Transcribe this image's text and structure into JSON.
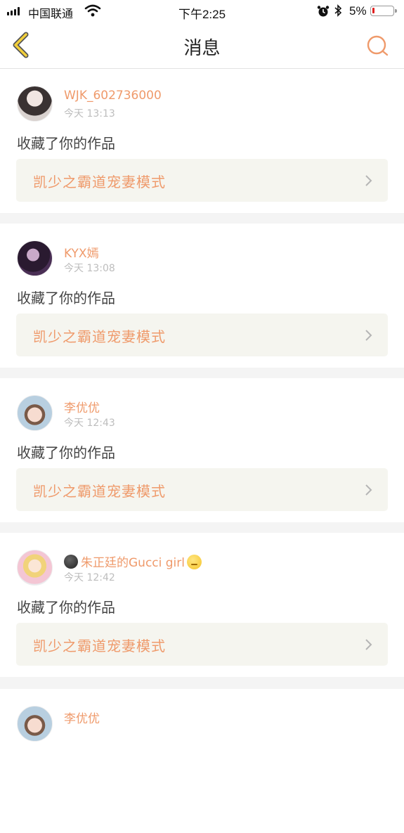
{
  "status_bar": {
    "carrier": "中国联通",
    "time": "下午2:25",
    "battery_percent": "5%"
  },
  "nav": {
    "title": "消息"
  },
  "colors": {
    "accent": "#ef9a6b",
    "card_link_bg": "#f5f5ef",
    "timestamp": "#bdbdbd"
  },
  "messages": [
    {
      "username": "WJK_602736000",
      "time": "今天 13:13",
      "action": "收藏了你的作品",
      "work_title": "凯少之霸道宠妻模式"
    },
    {
      "username": "KYX嫣",
      "time": "今天 13:08",
      "action": "收藏了你的作品",
      "work_title": "凯少之霸道宠妻模式"
    },
    {
      "username": "李优优",
      "time": "今天 12:43",
      "action": "收藏了你的作品",
      "work_title": "凯少之霸道宠妻模式"
    },
    {
      "username": "朱正廷的Gucci girl",
      "time": "今天 12:42",
      "action": "收藏了你的作品",
      "work_title": "凯少之霸道宠妻模式"
    },
    {
      "username": "李优优"
    }
  ]
}
